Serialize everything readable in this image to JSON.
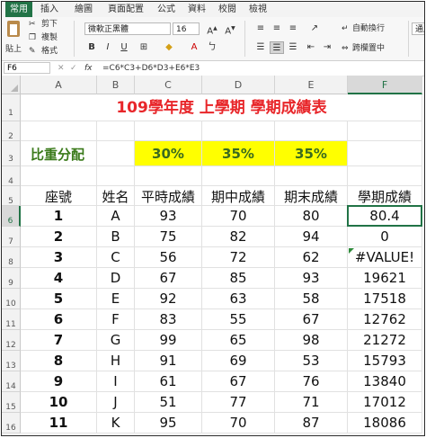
{
  "ribbon_tabs": [
    "常用",
    "插入",
    "繪圖",
    "頁面配置",
    "公式",
    "資料",
    "校閱",
    "檢視"
  ],
  "ribbon": {
    "paste_label": "貼上",
    "cut_label": "剪下",
    "copy_label": "複製",
    "format_label": "格式",
    "font_name": "微軟正黑體",
    "font_size": "16",
    "wrap_text": "自動換行",
    "merge_center": "跨欄置中",
    "number_format": "通用"
  },
  "formula_bar": {
    "cell_ref": "F6",
    "fx": "fx",
    "formula": "=C6*C3+D6*D3+E6*E3"
  },
  "columns": [
    "A",
    "B",
    "C",
    "D",
    "E",
    "F"
  ],
  "rows": [
    "1",
    "2",
    "3",
    "4",
    "5",
    "6",
    "7",
    "8",
    "9",
    "10",
    "11",
    "12",
    "13",
    "14",
    "15",
    "16"
  ],
  "sheet": {
    "title": "109學年度 上學期 學期成績表",
    "weight_label": "比重分配",
    "weights": [
      "30%",
      "35%",
      "35%"
    ],
    "headers": [
      "座號",
      "姓名",
      "平時成績",
      "期中成績",
      "期末成績",
      "學期成績"
    ],
    "records": [
      [
        "1",
        "A",
        "93",
        "70",
        "80",
        "80.4"
      ],
      [
        "2",
        "B",
        "75",
        "82",
        "94",
        "0"
      ],
      [
        "3",
        "C",
        "56",
        "72",
        "62",
        "#VALUE!"
      ],
      [
        "4",
        "D",
        "67",
        "85",
        "93",
        "19621"
      ],
      [
        "5",
        "E",
        "92",
        "63",
        "58",
        "17518"
      ],
      [
        "6",
        "F",
        "83",
        "55",
        "67",
        "12762"
      ],
      [
        "7",
        "G",
        "99",
        "65",
        "98",
        "21272"
      ],
      [
        "8",
        "H",
        "91",
        "69",
        "53",
        "15793"
      ],
      [
        "9",
        "I",
        "61",
        "67",
        "76",
        "13840"
      ],
      [
        "10",
        "J",
        "51",
        "77",
        "71",
        "17012"
      ],
      [
        "11",
        "K",
        "95",
        "70",
        "87",
        "18086"
      ]
    ]
  },
  "selected_cell": "F6",
  "colors": {
    "excel_green": "#217346",
    "title_red": "#e8262a",
    "weight_green": "#3a7a1a",
    "weight_fill": "#ffff00"
  }
}
